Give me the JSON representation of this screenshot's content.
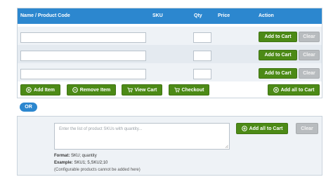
{
  "table": {
    "headers": {
      "name": "Name / Product Code",
      "sku": "SKU",
      "qty": "Qty",
      "price": "Price",
      "action": "Action"
    },
    "rows": [
      {
        "name_value": "",
        "qty_value": "",
        "add_label": "Add to Cart",
        "clear_label": "Clear"
      },
      {
        "name_value": "",
        "qty_value": "",
        "add_label": "Add to Cart",
        "clear_label": "Clear"
      },
      {
        "name_value": "",
        "qty_value": "",
        "add_label": "Add to Cart",
        "clear_label": "Clear"
      }
    ],
    "footer": {
      "add_item": "Add Item",
      "remove_item": "Remove Item",
      "view_cart": "View Cart",
      "checkout": "Checkout",
      "add_all": "Add all to Cart"
    }
  },
  "separator": {
    "or_label": "OR"
  },
  "bulk": {
    "placeholder": "Enter the list of product SKUs with quantity...",
    "add_all": "Add all to Cart",
    "clear": "Clear",
    "format_label": "Format:",
    "format_value": "SKU; quantity",
    "example_label": "Example:",
    "example_value": "SKU1; 5,SKU2;10",
    "note": "(Configurable products cannot be added here)"
  },
  "colors": {
    "header_blue": "#2c87cf",
    "button_green": "#4c8a16",
    "button_grey": "#b8bcbf"
  },
  "icons": {
    "add_item": "plus-circle-icon",
    "remove_item": "minus-circle-icon",
    "view_cart": "cart-icon",
    "checkout": "cart-icon",
    "add_all": "plus-circle-icon"
  }
}
